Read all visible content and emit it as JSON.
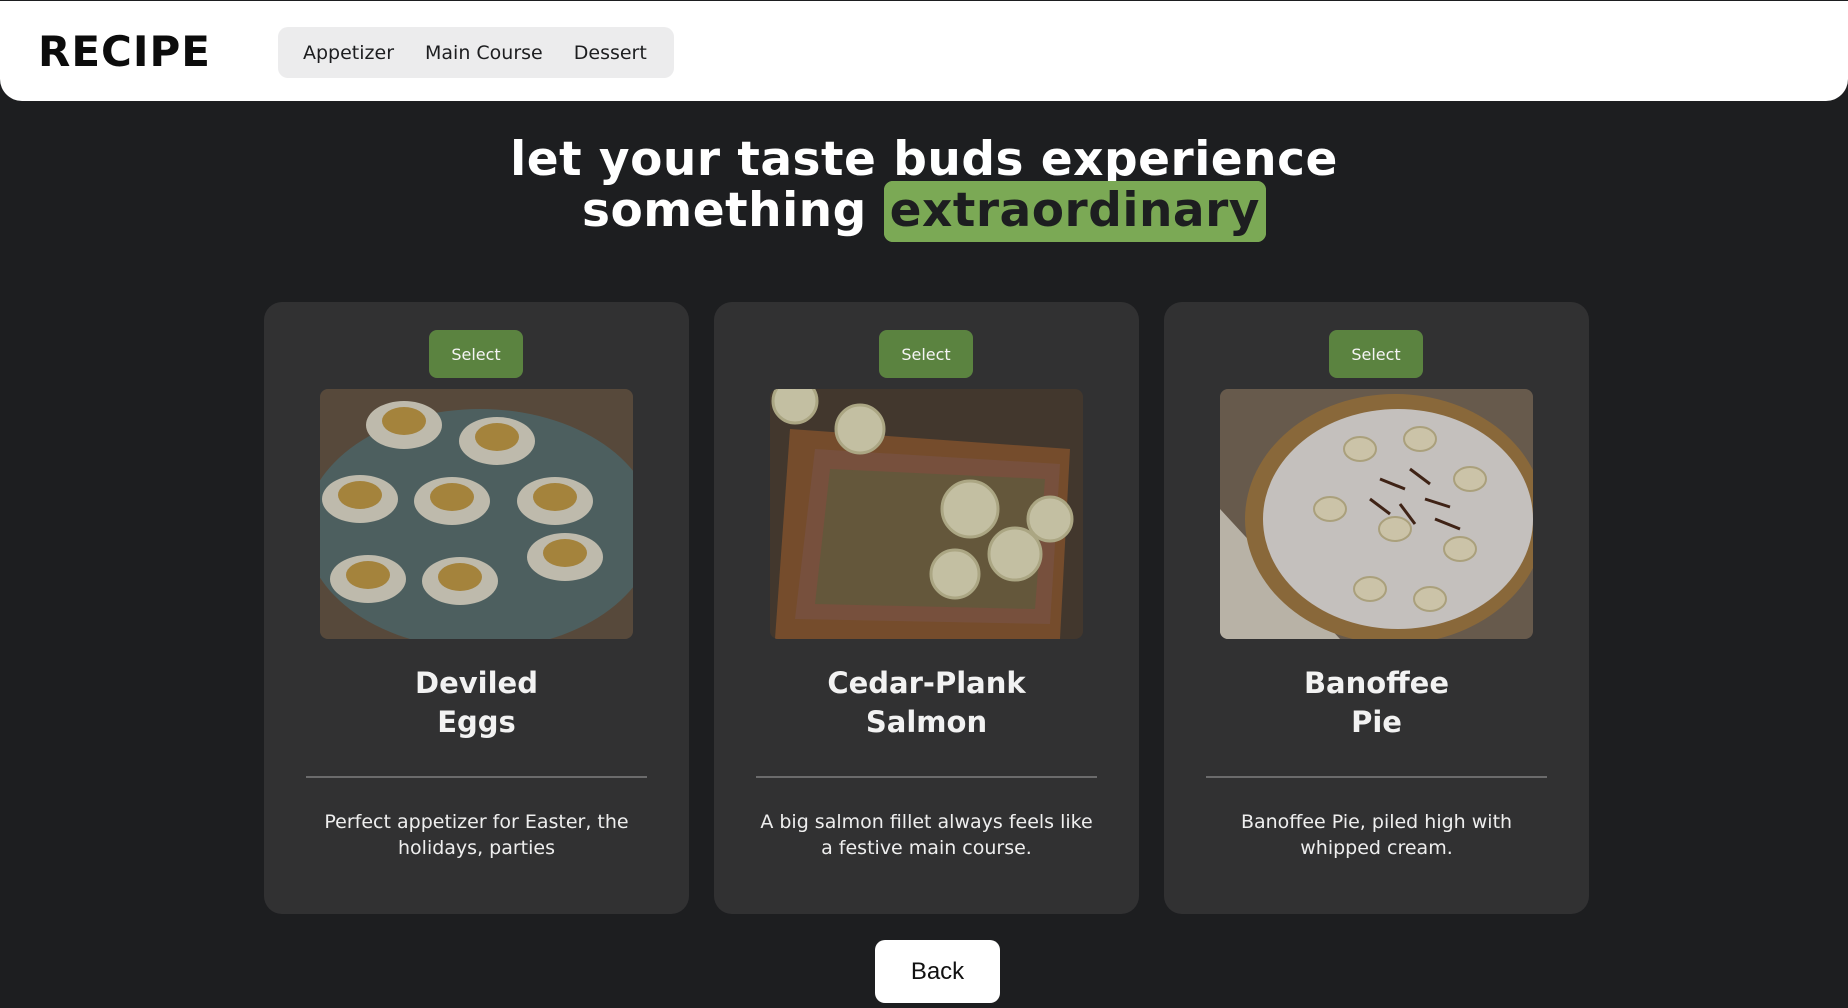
{
  "header": {
    "logo": "RECIPE",
    "nav": [
      "Appetizer",
      "Main Course",
      "Dessert"
    ]
  },
  "hero": {
    "line1": "let your taste buds experience",
    "line2_plain": "something",
    "line2_highlight": "extraordinary"
  },
  "cards": [
    {
      "button": "Select",
      "title_line1": "Deviled",
      "title_line2": "Eggs",
      "description": "Perfect appetizer for Easter, the holidays, parties",
      "image": "deviled-eggs-photo"
    },
    {
      "button": "Select",
      "title_line1": "Cedar-Plank",
      "title_line2": "Salmon",
      "description": "A big salmon fillet always feels like a festive main course.",
      "image": "cedar-plank-salmon-photo"
    },
    {
      "button": "Select",
      "title_line1": "Banoffee",
      "title_line2": "Pie",
      "description": "Banoffee Pie, piled high with whipped cream.",
      "image": "banoffee-pie-photo"
    }
  ],
  "footer": {
    "back_label": "Back"
  },
  "colors": {
    "background": "#1d1e20",
    "card": "#313132",
    "accent_green": "#5b8340",
    "highlight_green": "#7ba955"
  }
}
